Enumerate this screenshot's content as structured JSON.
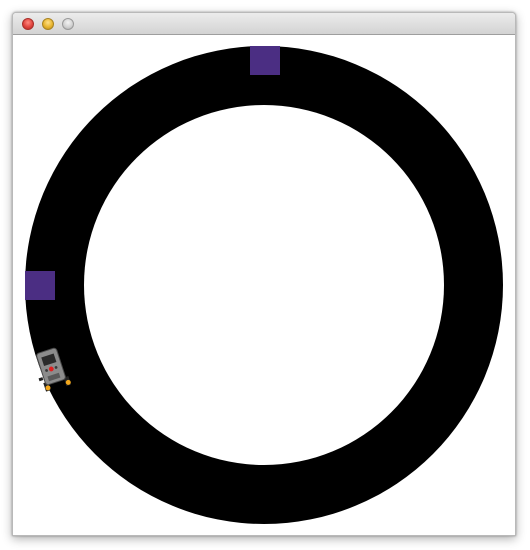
{
  "window": {
    "title": "",
    "controls": {
      "close": "close",
      "minimize": "minimize",
      "zoom": "zoom"
    }
  },
  "track": {
    "track_color": "#000000",
    "background_color": "#ffffff"
  },
  "markers": {
    "color": "#4b2e83"
  },
  "robot": {
    "icon": "robot-icon",
    "body_color": "#8c8c8c",
    "screen_color": "#2b2b2b",
    "led_color": "#e02020",
    "wheel_color": "#f4a81c"
  }
}
